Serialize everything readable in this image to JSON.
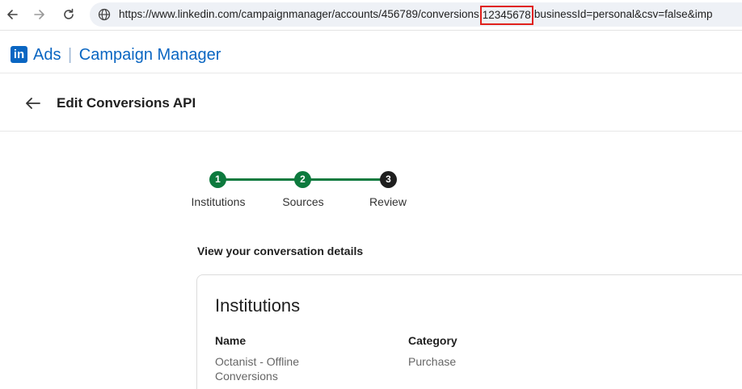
{
  "browser": {
    "url_before": "https://www.linkedin.com/campaignmanager/accounts/456789/conversions",
    "url_highlight": "12345678",
    "url_after": "businessId=personal&csv=false&imp"
  },
  "app": {
    "logo_text": "in",
    "product": "Ads",
    "separator": "|",
    "name": "Campaign Manager",
    "brand_color": "#0a66c2"
  },
  "page": {
    "title": "Edit Conversions API"
  },
  "stepper": {
    "steps": [
      {
        "number": "1",
        "label": "Institutions",
        "state": "complete"
      },
      {
        "number": "2",
        "label": "Sources",
        "state": "complete"
      },
      {
        "number": "3",
        "label": "Review",
        "state": "current"
      }
    ],
    "complete_color": "#0d7a3e",
    "current_color": "#1f1f1f"
  },
  "section": {
    "heading": "View your conversation details"
  },
  "card": {
    "title": "Institutions",
    "fields": [
      {
        "label": "Name",
        "value": "Octanist - Offline Conversions"
      },
      {
        "label": "Category",
        "value": "Purchase"
      }
    ]
  }
}
